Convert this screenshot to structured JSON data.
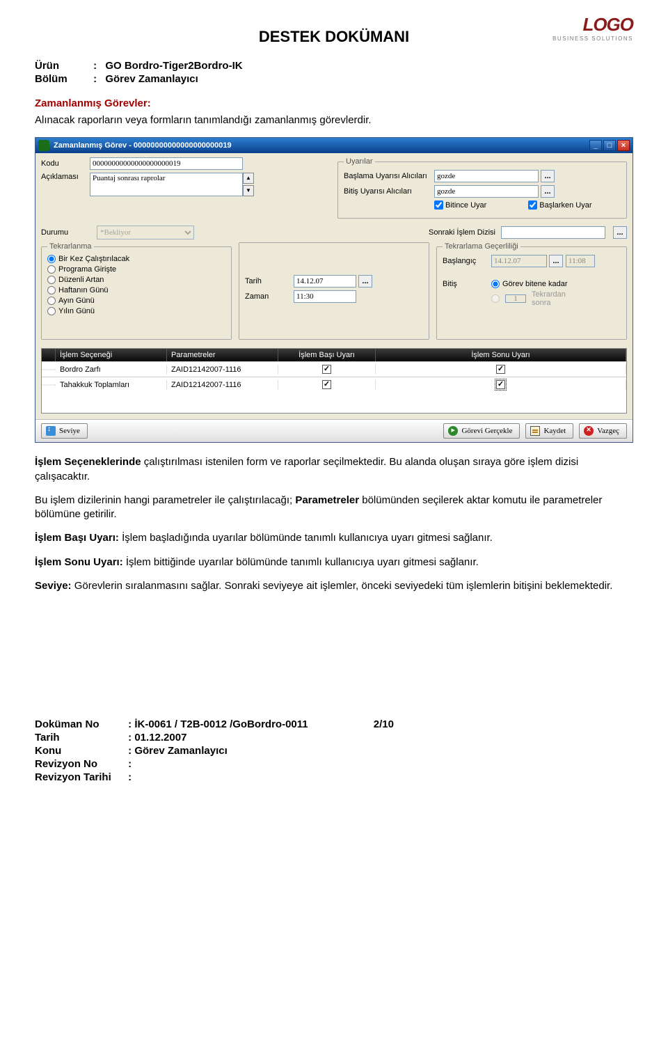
{
  "logo": {
    "brand": "LOGO",
    "sub": "BUSINESS SOLUTIONS"
  },
  "page_title": "DESTEK DOKÜMANI",
  "meta": {
    "urun_label": "Ürün",
    "urun_val": "GO Bordro-Tiger2Bordro-IK",
    "bolum_label": "Bölüm",
    "bolum_val": "Görev Zamanlayıcı"
  },
  "section_head": "Zamanlanmış Görevler:",
  "intro_text": "Alınacak raporların veya formların tanımlandığı zamanlanmış görevlerdir.",
  "window": {
    "title": "Zamanlanmış Görev - 00000000000000000000019",
    "kodu_label": "Kodu",
    "kodu_val": "00000000000000000000019",
    "aciklama_label": "Açıklaması",
    "aciklama_val": "Puantaj sonrası raprolar",
    "uyarilar_legend": "Uyarılar",
    "baslama_label": "Başlama Uyarısı Alıcıları",
    "baslama_val": "gozde",
    "bitis_label": "Bitiş Uyarısı Alıcıları",
    "bitis_val": "gozde",
    "bitince_uyar": "Bitince Uyar",
    "baslarken_uyar": "Başlarken Uyar",
    "durumu_label": "Durumu",
    "durumu_val": "*Bekliyor",
    "sonraki_label": "Sonraki İşlem Dizisi",
    "tekrarlanma_legend": "Tekrarlanma",
    "radios": [
      "Bir Kez Çalıştırılacak",
      "Programa Girişte",
      "Düzenli Artan",
      "Haftanın Günü",
      "Ayın Günü",
      "Yılın Günü"
    ],
    "tarih_label": "Tarih",
    "tarih_val": "14.12.07",
    "zaman_label": "Zaman",
    "zaman_val": "11:30",
    "gecer_legend": "Tekrarlama Geçerliliği",
    "baslangic_label": "Başlangıç",
    "baslangic_val": "14.12.07",
    "baslangic_time": "11:08",
    "bitis2_label": "Bitiş",
    "gorev_bitene": "Görev bitene kadar",
    "tekrardan_val": "1",
    "tekrardan_sonra": "Tekrardan sonra",
    "grid": {
      "headers": [
        "İşlem Seçeneği",
        "Parametreler",
        "İşlem Başı Uyarı",
        "İşlem Sonu Uyarı"
      ],
      "rows": [
        {
          "c1": "Bordro Zarfı",
          "c2": "ZAID12142007-1116",
          "c3": true,
          "c4": true
        },
        {
          "c1": "Tahakkuk Toplamları",
          "c2": "ZAID12142007-1116",
          "c3": true,
          "c4": true
        }
      ]
    },
    "btn_seviye": "Seviye",
    "btn_gercekle": "Görevi Gerçekle",
    "btn_kaydet": "Kaydet",
    "btn_vazgec": "Vazgeç"
  },
  "paragraphs": {
    "p1a": "İşlem Seçeneklerinde",
    "p1b": " çalıştırılması istenilen form ve raporlar seçilmektedir. Bu alanda oluşan sıraya göre işlem dizisi çalışacaktır.",
    "p2a": "Bu işlem dizilerinin hangi parametreler ile çalıştırılacağı; ",
    "p2b": "Parametreler",
    "p2c": " bölümünden seçilerek aktar komutu ile parametreler bölümüne getirilir.",
    "p3a": "İşlem Başı Uyarı:",
    "p3b": " İşlem başladığında uyarılar bölümünde tanımlı kullanıcıya uyarı gitmesi sağlanır.",
    "p4a": "İşlem Sonu Uyarı:",
    "p4b": " İşlem bittiğinde uyarılar bölümünde tanımlı kullanıcıya uyarı gitmesi sağlanır.",
    "p5a": "Seviye:",
    "p5b": " Görevlerin sıralanmasını sağlar. Sonraki seviyeye ait işlemler, önceki seviyedeki tüm işlemlerin bitişini beklemektedir."
  },
  "footer": {
    "dokuman_label": "Doküman No",
    "dokuman_val": "İK-0061 / T2B-0012 /GoBordro-0011",
    "page_num": "2/10",
    "tarih_label": "Tarih",
    "tarih_val": "01.12.2007",
    "konu_label": "Konu",
    "konu_val": "Görev Zamanlayıcı",
    "revno_label": "Revizyon No",
    "revtarih_label": "Revizyon Tarihi"
  }
}
